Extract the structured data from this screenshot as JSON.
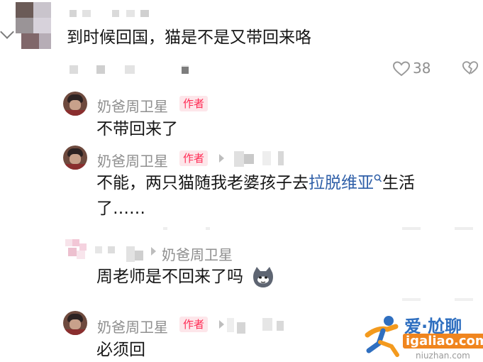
{
  "top_comment": {
    "text": "到时候回国，猫是不是又带回来咯",
    "like_count": "38"
  },
  "replies": [
    {
      "author": "奶爸周卫星",
      "badge": "作者",
      "text": "不带回来了"
    },
    {
      "author": "奶爸周卫星",
      "badge": "作者",
      "text_before_link": "不能，两只猫随我老婆孩子去",
      "link_text": "拉脱维亚",
      "text_after_link": "生活",
      "text_line2": "了……"
    },
    {
      "reply_to": "奶爸周卫星",
      "text": "周老师是不回来了吗"
    },
    {
      "author": "奶爸周卫星",
      "badge": "作者",
      "text": "必须回"
    }
  ],
  "watermark": {
    "brand": "爱·尬聊",
    "site": "igaliao.com",
    "site2": "niuzhan.com"
  },
  "colors": {
    "badge_text": "#ff2c55",
    "badge_bg": "#fde6ea",
    "link": "#2f5fa8",
    "muted": "#8f8f8f"
  }
}
